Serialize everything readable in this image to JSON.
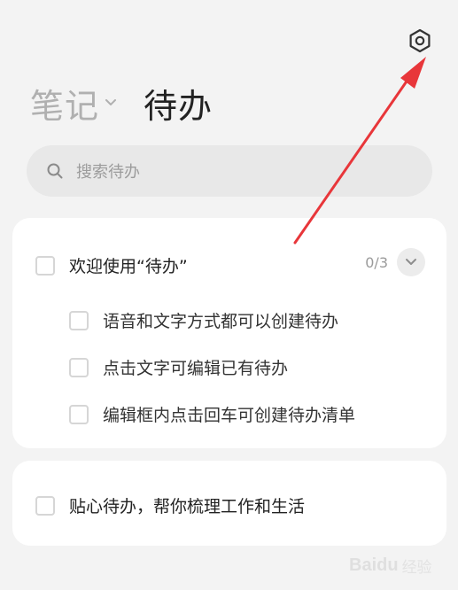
{
  "header": {
    "tab_notes": "笔记",
    "tab_todo": "待办"
  },
  "search": {
    "placeholder": "搜索待办"
  },
  "groups": [
    {
      "title": "欢迎使用“待办”",
      "count": "0/3",
      "items": [
        {
          "text": "语音和文字方式都可以创建待办",
          "checked": false
        },
        {
          "text": "点击文字可编辑已有待办",
          "checked": false
        },
        {
          "text": "编辑框内点击回车可创建待办清单",
          "checked": false
        }
      ]
    },
    {
      "title": "贴心待办，帮你梳理工作和生活",
      "checked": false
    }
  ],
  "icons": {
    "settings": "hexagon-settings-icon",
    "chevron": "chevron-down-icon",
    "search": "search-icon"
  },
  "watermark": {
    "brand": "Baidu",
    "sub": "经验"
  },
  "colors": {
    "annotation_arrow": "#e8363a",
    "background": "#f3f3f3",
    "card": "#ffffff"
  }
}
